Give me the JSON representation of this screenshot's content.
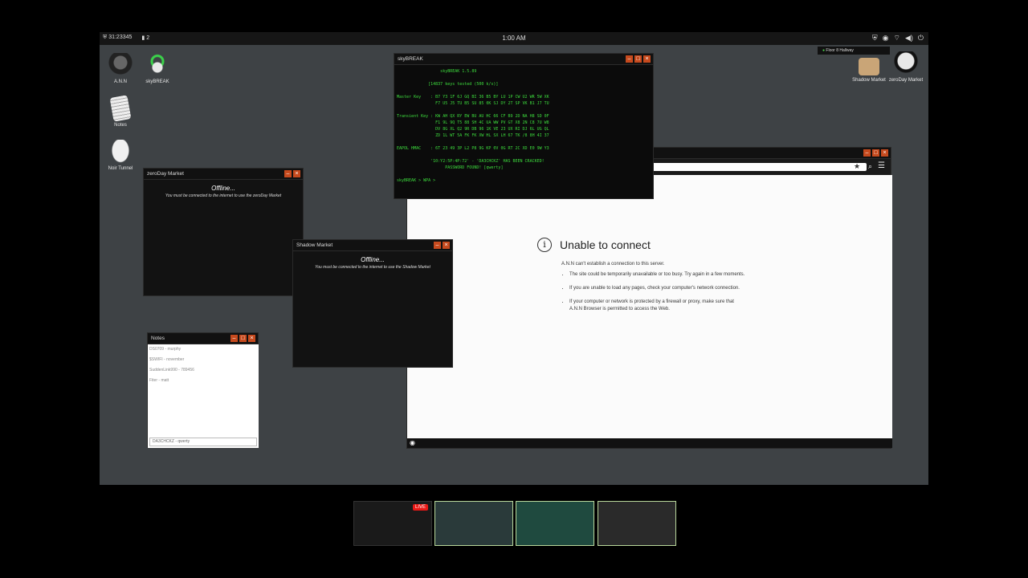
{
  "taskbar": {
    "id_text": "31:23345",
    "count_text": "2",
    "clock": "1:00 AM",
    "location": "Floor 8 Hallway"
  },
  "desktop_icons": [
    {
      "label": "A.N.N",
      "icon": "hacker-icon"
    },
    {
      "label": "skyBREAK",
      "icon": "wifi-lock-icon"
    },
    {
      "label": "Notes",
      "icon": "notepad-icon"
    },
    {
      "label": "Noir Tunnel",
      "icon": "mask-icon"
    },
    {
      "label": "Shadow Market",
      "icon": "box-icon"
    },
    {
      "label": "zeroDay Market",
      "icon": "skull-icon"
    }
  ],
  "zeroday_window": {
    "title": "zeroDay Market",
    "status": "Offline...",
    "message": "You must be connected to the internet to use the zeroDay Market"
  },
  "shadow_window": {
    "title": "Shadow Market",
    "status": "Offline...",
    "message": "You must be connected to the internet to use the Shadow Market"
  },
  "skybreak_window": {
    "title": "skyBREAK",
    "lines": [
      "                  skyBREAK 1.5.89",
      "",
      "             [14837 keys tested (500 k/s)]",
      "",
      "Master Key    : B7 Y3 1F 6J GQ BI 36 B5 BY LU 1P CW U2 WR 5W XK",
      "                F7 U5 J5 TU B5 SU 85 0K SJ DY 2T SP VK B1 J7 TU",
      "",
      "Transient Key : KW AH QX RY EW BU AU HC 66 CF B9 2D NA H8 SD 0F",
      "                F1 9L 9Q T5 88 SH 4C UA WW PV GT X8 2N C8 7U W8",
      "                DV 8G XL Q2 9R DB 96 1K VE 23 UX RI DJ 6L UG QL",
      "                ZD 1L WT 5A FK FK XW HL SX LH 67 TK /8 8H 4I 37",
      "",
      "EAPOL HMAC    : 6T 23 49 3P L2 P8 9G KP 0V 0G RT 2C XD E0 9W Y3",
      "",
      "              '10:Y2:5P:4P:72' - 'DA3CHCKZ' HAS BEEN CRACKED!",
      "                    PASSWORD FOUND! [qwerty]",
      "",
      "skyBREAK > WPA >"
    ]
  },
  "browser_window": {
    "error_title": "Unable to connect",
    "error_sub": "A.N.N can't establish a connection to this server.",
    "bullets": [
      "The site could be temporarily unavailable or too busy. Try again in a few moments.",
      "If you are unable to load any pages, check your computer's network connection.",
      "If your computer or network is protected by a firewall or proxy, make sure that A.N.N Browser is permitted to access the Web."
    ]
  },
  "notes_window": {
    "title": "Notes",
    "lines": [
      "DS0709 - murphy",
      "$SWIFI - november",
      "SuddenLink990 - 789456",
      "Fiter - matt"
    ],
    "input_value": "DA3CHCKZ - qwerty"
  },
  "stream": {
    "live_label": "LIVE"
  },
  "colors": {
    "accent": "#c64a1e",
    "terminal_green": "#3ddc3d",
    "desktop": "#3e4245"
  }
}
